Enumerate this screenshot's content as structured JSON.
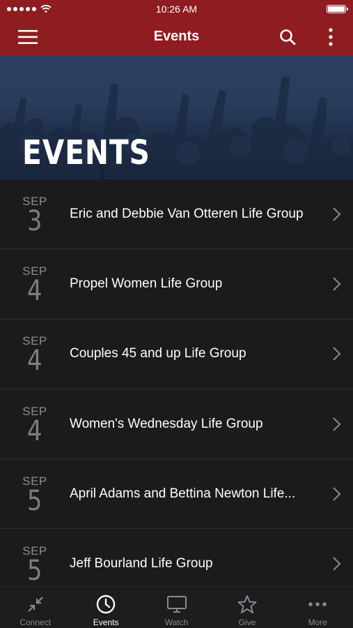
{
  "status_bar": {
    "time": "10:26 AM"
  },
  "nav": {
    "title": "Events"
  },
  "hero": {
    "title": "EVENTS"
  },
  "events": [
    {
      "month": "SEP",
      "day": "3",
      "title": "Eric and Debbie Van Otteren Life Group"
    },
    {
      "month": "SEP",
      "day": "4",
      "title": "Propel Women Life Group"
    },
    {
      "month": "SEP",
      "day": "4",
      "title": "Couples 45 and up Life Group"
    },
    {
      "month": "SEP",
      "day": "4",
      "title": "Women's Wednesday Life Group"
    },
    {
      "month": "SEP",
      "day": "5",
      "title": "April Adams and Bettina Newton Life..."
    },
    {
      "month": "SEP",
      "day": "5",
      "title": "Jeff Bourland Life Group"
    }
  ],
  "tabs": [
    {
      "label": "Connect",
      "icon": "connect-icon"
    },
    {
      "label": "Events",
      "icon": "clock-icon",
      "active": true
    },
    {
      "label": "Watch",
      "icon": "monitor-icon"
    },
    {
      "label": "Give",
      "icon": "star-icon"
    },
    {
      "label": "More",
      "icon": "more-dots-icon"
    }
  ],
  "colors": {
    "brand": "#8e1c21",
    "background": "#1b1b1d",
    "hero": "#34507a"
  }
}
